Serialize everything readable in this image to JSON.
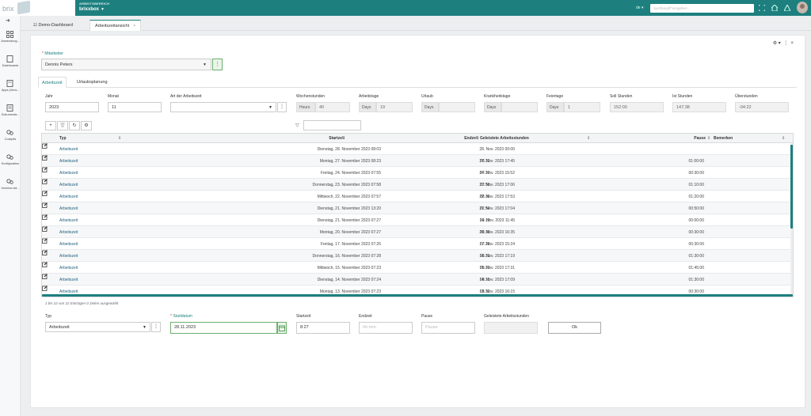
{
  "topbar": {
    "brand": "brix",
    "workspace_label": "ARBEITSBEREICH",
    "workspace_name": "brixxbox",
    "language": "de",
    "search_placeholder": "Suchbegriff eingeben..."
  },
  "sidebar": {
    "items": [
      {
        "label": "Anwendung...",
        "icon": "grid-icon"
      },
      {
        "label": "Dashboards",
        "icon": "dashboard-icon"
      },
      {
        "label": "Apps (Verw...",
        "icon": "apps-icon"
      },
      {
        "label": "Dokumenta...",
        "icon": "book-icon"
      },
      {
        "label": "Cockpits",
        "icon": "cogs-icon"
      },
      {
        "label": "Konfiguration",
        "icon": "cogs-icon"
      },
      {
        "label": "brixxbox Ad...",
        "icon": "cogs-icon"
      }
    ]
  },
  "tabs": [
    {
      "label": "Demo-Dashboard",
      "active": false
    },
    {
      "label": "Arbeitszeitansicht",
      "active": true
    }
  ],
  "form": {
    "employee_label": "Mitarbeiter",
    "employee_value": "Dennis Peters",
    "subtabs": [
      "Arbeitszeit",
      "Urlaubsplanung"
    ],
    "fields": {
      "jahr_label": "Jahr",
      "jahr_value": "2023",
      "monat_label": "Monat",
      "monat_value": "11",
      "art_label": "Art der Arbeitszeit",
      "art_value": "",
      "wochenstunden_label": "Wochenstunden",
      "wochenstunden_unit": "Hours",
      "wochenstunden_value": "40",
      "arbeitstage_label": "Arbeitstage",
      "arbeitstage_unit": "Days",
      "arbeitstage_value": "19",
      "urlaub_label": "Urlaub",
      "urlaub_unit": "Days",
      "urlaub_value": "",
      "krankheit_label": "Krankheitstage",
      "krankheit_unit": "Days",
      "krankheit_value": "",
      "feiertage_label": "Feiertage",
      "feiertage_unit": "Days",
      "feiertage_value": "1",
      "soll_label": "Soll Stunden",
      "soll_value": "152:00",
      "ist_label": "Ist Stunden",
      "ist_value": "147:38",
      "ueber_label": "Überstunden",
      "ueber_value": "-04:22"
    }
  },
  "grid": {
    "columns": [
      "Typ",
      "Startzeit",
      "Endzeit",
      "Geleistete Arbeitsstunden",
      "Pause",
      "Bemerken"
    ],
    "rows": [
      {
        "typ": "Arbeitszeit",
        "start": "Dienstag, 28. November 2023 08:03",
        "end": "28. Nov. 2023 00:00",
        "dur": "",
        "pause": ""
      },
      {
        "typ": "Arbeitszeit",
        "start": "Montag, 27. November 2023 08:23",
        "end": "27. Nov. 2023 17:45",
        "dur": "08:22",
        "pause": "01:00:00"
      },
      {
        "typ": "Arbeitszeit",
        "start": "Freitag, 24. November 2023 07:55",
        "end": "24. Nov. 2023 15:52",
        "dur": "07:27",
        "pause": "00:30:00"
      },
      {
        "typ": "Arbeitszeit",
        "start": "Donnerstag, 23. November 2023 07:58",
        "end": "23. Nov. 2023 17:06",
        "dur": "07:58",
        "pause": "01:10:00"
      },
      {
        "typ": "Arbeitszeit",
        "start": "Mittwoch, 22. November 2023 07:57",
        "end": "22. Nov. 2023 17:53",
        "dur": "08:36",
        "pause": "01:20:00"
      },
      {
        "typ": "Arbeitszeit",
        "start": "Dienstag, 21. November 2023 13:20",
        "end": "21. Nov. 2023 17:04",
        "dur": "02:54",
        "pause": "00:50:00"
      },
      {
        "typ": "Arbeitszeit",
        "start": "Dienstag, 21. November 2023 07:27",
        "end": "21. Nov. 2023 11:45",
        "dur": "04:18",
        "pause": "00:00:00"
      },
      {
        "typ": "Arbeitszeit",
        "start": "Montag, 20. November 2023 07:27",
        "end": "20. Nov. 2023 16:35",
        "dur": "08:38",
        "pause": "00:30:00"
      },
      {
        "typ": "Arbeitszeit",
        "start": "Freitag, 17. November 2023 07:26",
        "end": "17. Nov. 2023 15:24",
        "dur": "07:28",
        "pause": "00:30:00"
      },
      {
        "typ": "Arbeitszeit",
        "start": "Donnerstag, 16. November 2023 07:28",
        "end": "16. Nov. 2023 17:19",
        "dur": "08:21",
        "pause": "01:30:00"
      },
      {
        "typ": "Arbeitszeit",
        "start": "Mittwoch, 15. November 2023 07:23",
        "end": "15. Nov. 2023 17:31",
        "dur": "08:23",
        "pause": "01:45:00"
      },
      {
        "typ": "Arbeitszeit",
        "start": "Dienstag, 14. November 2023 07:24",
        "end": "14. Nov. 2023 17:09",
        "dur": "08:15",
        "pause": "01:30:00"
      },
      {
        "typ": "Arbeitszeit",
        "start": "Montag, 13. November 2023 07:23",
        "end": "13. Nov. 2023 16:15",
        "dur": "08:32",
        "pause": "00:30:00"
      }
    ],
    "footer": "1 bis 22 von 22 Einträgen     0 Zeilen ausgewählt"
  },
  "entry": {
    "typ_label": "Typ",
    "typ_value": "Arbeitszeit",
    "startdatum_label": "Startdatum",
    "startdatum_value": "28.11.2023",
    "startzeit_label": "Startzeit",
    "startzeit_value": "8:27",
    "endzeit_label": "Endzeit",
    "endzeit_placeholder": "hh:mm",
    "pause_label": "Pause",
    "pause_placeholder": "Pause",
    "geleistet_label": "Geleistete Arbeitsstunden",
    "geleistet_value": "",
    "ok_label": "Ok"
  },
  "colors": {
    "accent": "#1e7f7f",
    "green": "#3a8a3a"
  }
}
